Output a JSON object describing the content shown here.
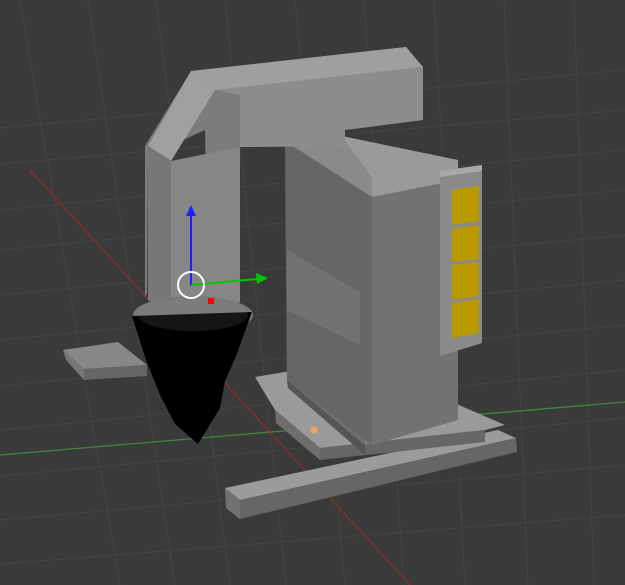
{
  "viewport": {
    "background": "#3a3a3a",
    "grid_color": "#444444",
    "x_axis_color": "#8b2f2f",
    "y_axis_color": "#3f8f3f"
  },
  "scene": {
    "object_base_color": "#7c7c7c",
    "object_dark_color": "#5f5f5f",
    "object_light_color": "#9c9c9c",
    "indicator_color": "#b89a00",
    "tool_tip_color": "#000000"
  },
  "gizmo": {
    "x_handle_color": "#00c800",
    "z_handle_color": "#2020ff",
    "origin_color": "#ffffff",
    "active_dot_color": "#ff0000",
    "light_dot_color": "#f2a25a"
  }
}
